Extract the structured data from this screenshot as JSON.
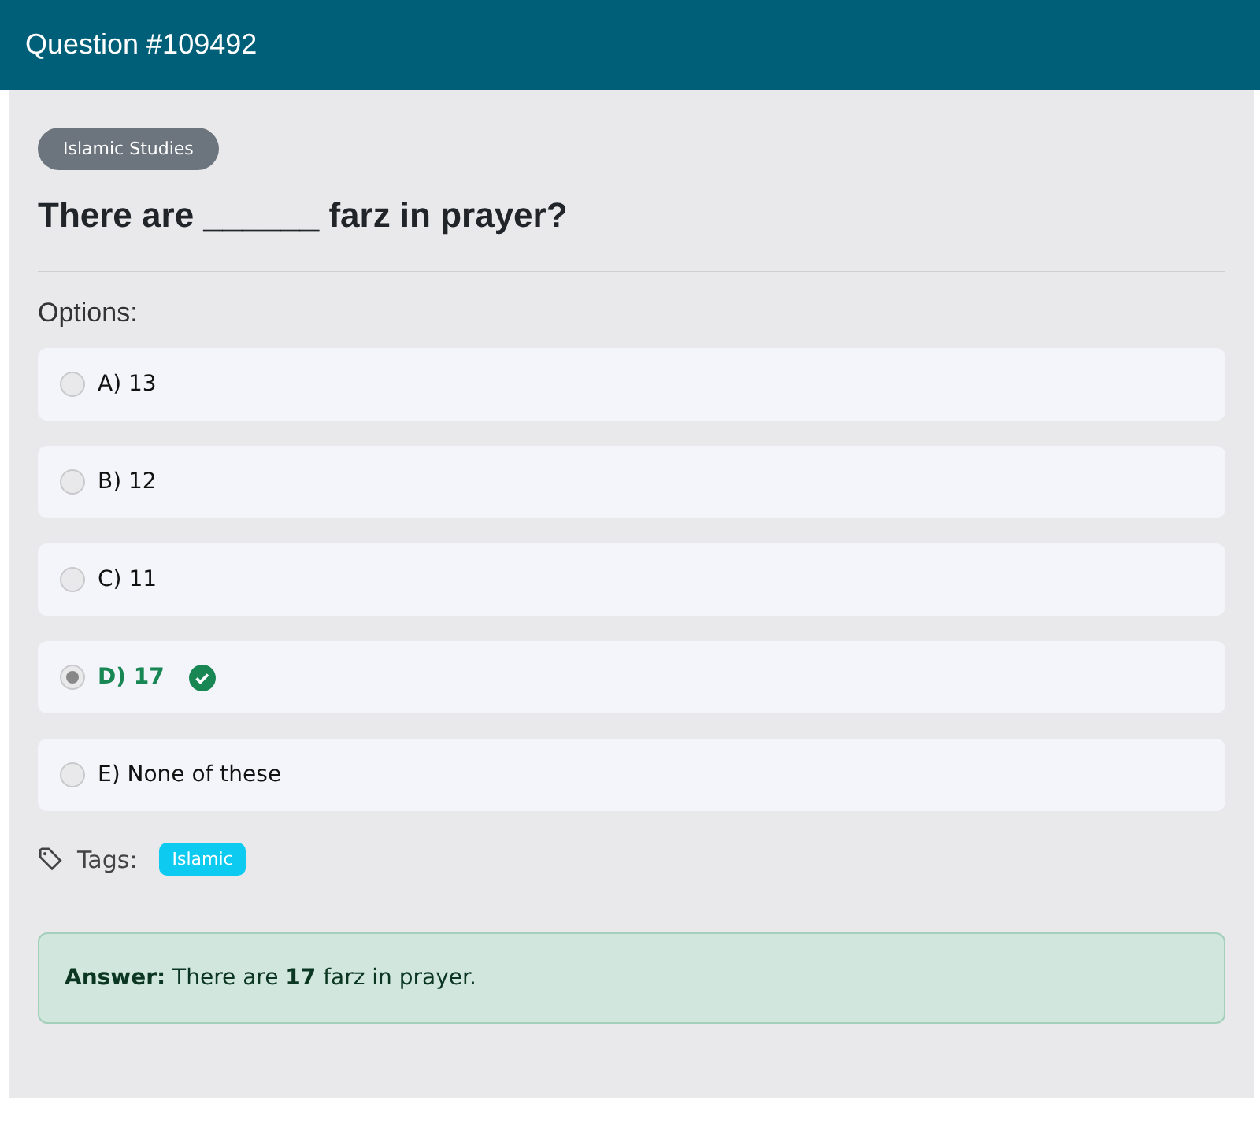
{
  "header": {
    "title": "Question #109492"
  },
  "category": "Islamic Studies",
  "question": "There are ______ farz in prayer?",
  "options_label": "Options:",
  "options": [
    {
      "label": "A) 13",
      "selected": false,
      "correct": false
    },
    {
      "label": "B) 12",
      "selected": false,
      "correct": false
    },
    {
      "label": "C) 11",
      "selected": false,
      "correct": false
    },
    {
      "label": "D) 17",
      "selected": true,
      "correct": true
    },
    {
      "label": "E) None of these",
      "selected": false,
      "correct": false
    }
  ],
  "tags_label": "Tags:",
  "tags": [
    "Islamic"
  ],
  "answer": "**Answer:** There are **17** farz in prayer."
}
